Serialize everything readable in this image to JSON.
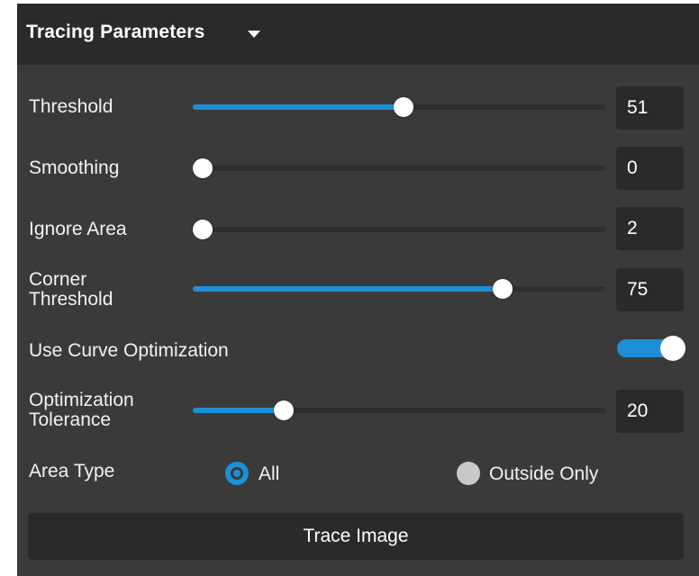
{
  "panel": {
    "title": "Tracing Parameters",
    "collapse_icon": "chevron-down-icon"
  },
  "params": {
    "threshold": {
      "label": "Threshold",
      "value": "51",
      "fraction": 0.51
    },
    "smoothing": {
      "label": "Smoothing",
      "value": "0",
      "fraction": 0.0
    },
    "ignore_area": {
      "label": "Ignore Area",
      "value": "2",
      "fraction": 0.02
    },
    "corner_threshold": {
      "label_line1": "Corner",
      "label_line2": "Threshold",
      "value": "75",
      "fraction": 0.75
    },
    "use_curve_optimization": {
      "label": "Use Curve Optimization",
      "enabled": true
    },
    "optimization_tolerance": {
      "label_line1": "Optimization",
      "label_line2": "Tolerance",
      "value": "20",
      "fraction": 0.22
    }
  },
  "area_type": {
    "label": "Area Type",
    "options": [
      {
        "label": "All",
        "selected": true
      },
      {
        "label": "Outside Only",
        "selected": false
      }
    ]
  },
  "actions": {
    "trace_label": "Trace Image"
  },
  "colors": {
    "accent": "#1e8fd6",
    "panel_bg": "#3a3a3a",
    "header_bg": "#2a2a2a"
  }
}
